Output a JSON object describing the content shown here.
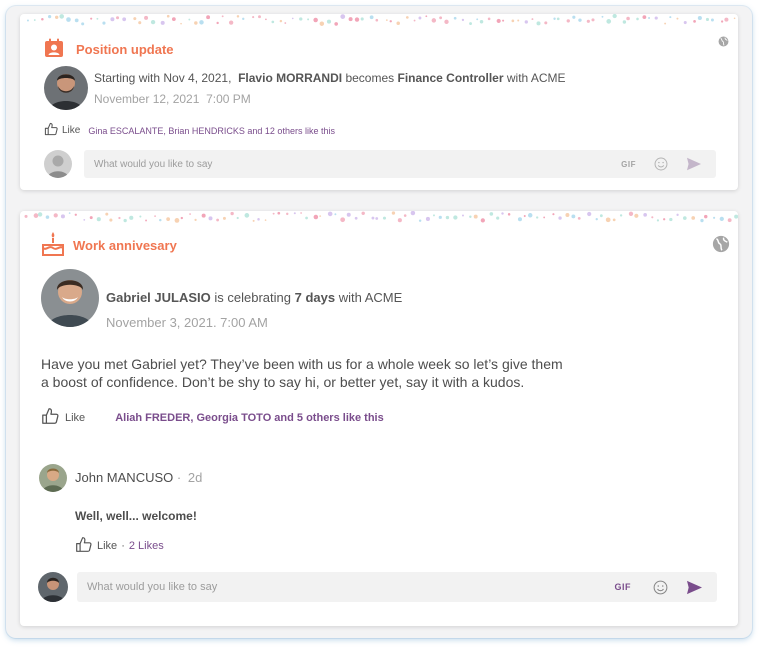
{
  "position_card": {
    "title": "Position update",
    "text_prefix": "Starting with Nov 4, 2021,",
    "person": "Flavio MORRANDI",
    "text_middle": "becomes",
    "role": "Finance Controller",
    "text_suffix": "with ACME",
    "timestamp": "November 12, 2021  7:00 PM",
    "like_label": "Like",
    "likes_text": "Gina ESCALANTE, Brian HENDRICKS and 12 others like this",
    "comment_placeholder": "What would you like to say",
    "gif_label": "GIF"
  },
  "anniversary_card": {
    "title": "Work annivesary",
    "person": "Gabriel JULASIO",
    "text_middle": "is celebrating",
    "duration": "7 days",
    "text_suffix": "with ACME",
    "timestamp": "November 3, 2021. 7:00 AM",
    "message_line1": "Have you met Gabriel yet? They’ve been with us for a whole week so let’s give them",
    "message_line2": "a boost of confidence. Don’t be shy to say hi, or better yet, say it with a kudos.",
    "like_label": "Like",
    "likes_text": "Aliah FREDER, Georgia TOTO and 5 others like this",
    "comment": {
      "author": "John MANCUSO",
      "separator": "·",
      "age": "2d",
      "text": "Well, well... welcome!",
      "like_label": "Like",
      "dot": "·",
      "likes_count": "2 Likes"
    },
    "comment_placeholder": "What would you like to say",
    "gif_label": "GIF"
  },
  "colors": {
    "accent_orange": "#f07651",
    "accent_purple": "#7a4d8c",
    "muted_text": "#a3a3a3"
  },
  "icons": [
    "badge-icon",
    "cake-icon",
    "globe-icon",
    "thumbs-up-icon",
    "emoji-icon",
    "send-icon"
  ]
}
